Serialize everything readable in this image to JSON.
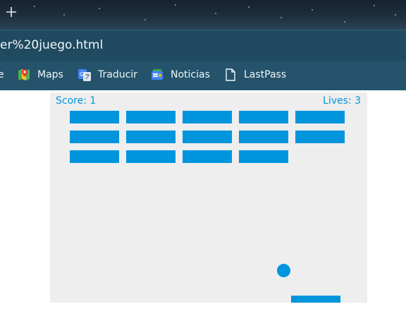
{
  "browser": {
    "url_visible": "er%20juego.html",
    "bookmarks": {
      "partial_label": "e",
      "items": [
        {
          "label": "Maps",
          "icon": "maps-icon"
        },
        {
          "label": "Traducir",
          "icon": "translate-icon"
        },
        {
          "label": "Noticias",
          "icon": "news-icon"
        },
        {
          "label": "LastPass",
          "icon": "page-icon"
        }
      ]
    }
  },
  "game": {
    "score_text": "Score: 1",
    "lives_text": "Lives: 3",
    "score": 1,
    "lives": 3,
    "brick_grid": {
      "columns": 5,
      "rows": 3,
      "bricks_remaining": 14,
      "destroyed": [
        {
          "row": 3,
          "column": 5
        }
      ]
    },
    "colors": {
      "brick": "#0095dd",
      "ball": "#0095dd",
      "paddle": "#0095dd",
      "text": "#0095dd",
      "background": "#eeeeee"
    }
  }
}
